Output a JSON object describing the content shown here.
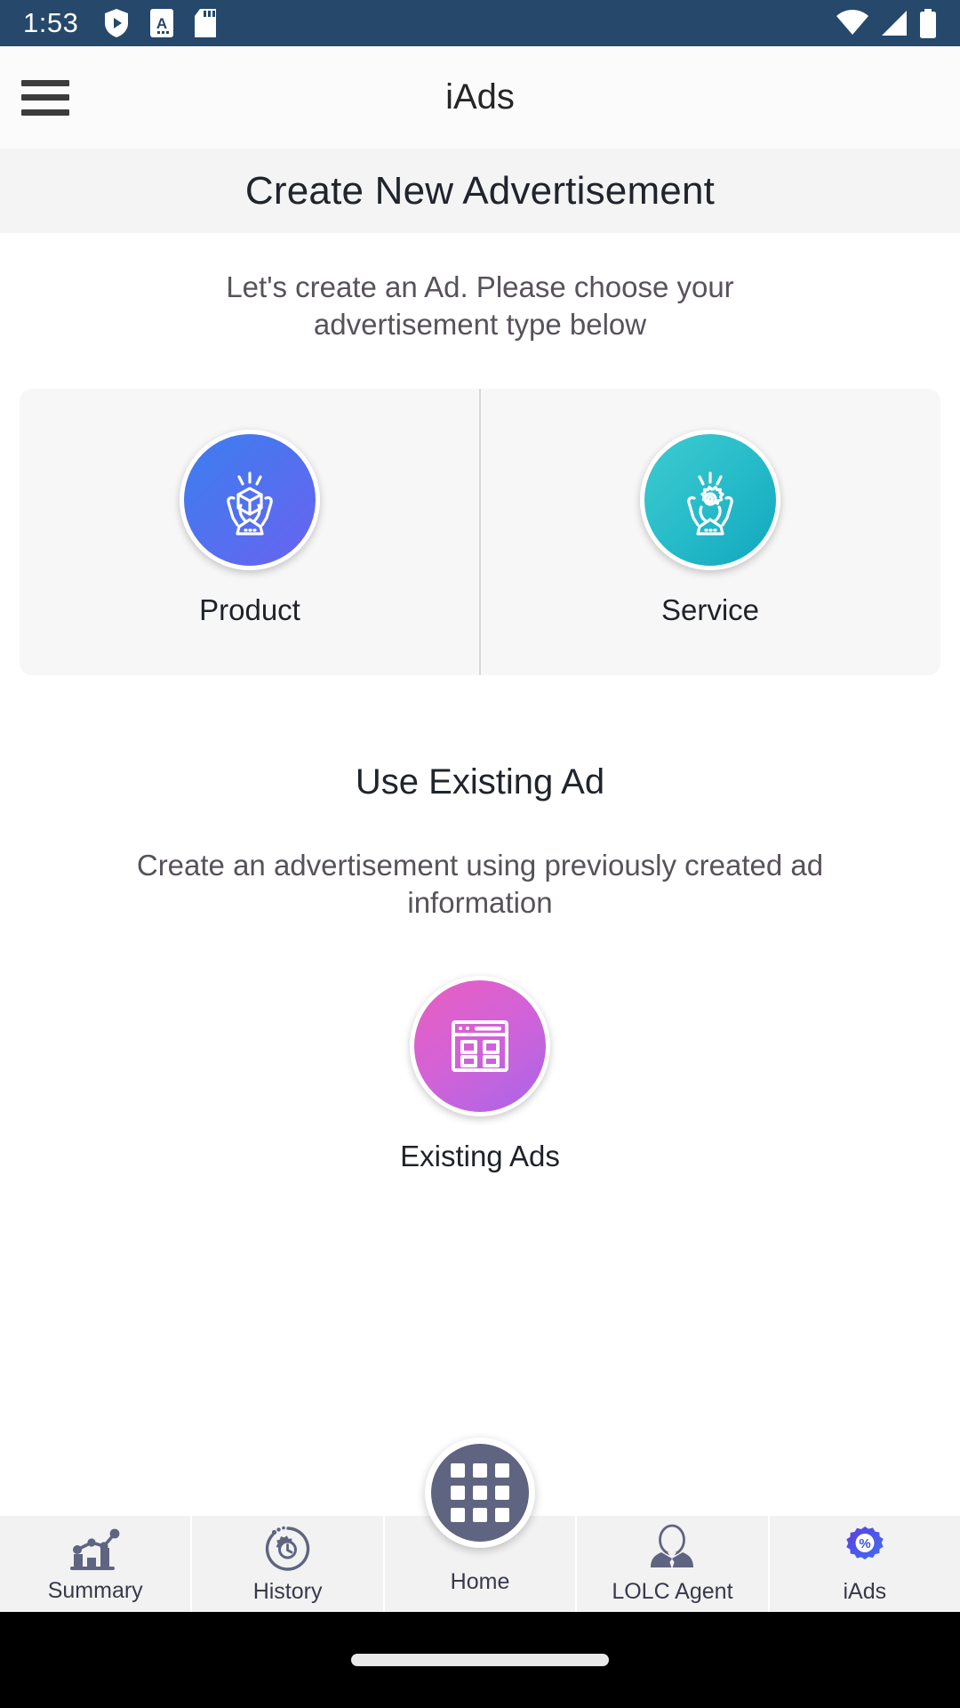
{
  "status_bar": {
    "time": "1:53",
    "left_icons": [
      "play-protect-shield-icon",
      "document-a-icon",
      "sd-card-icon"
    ],
    "right_icons": [
      "wifi-icon",
      "cellular-signal-icon",
      "battery-icon"
    ],
    "background_color": "#25486b"
  },
  "app_bar": {
    "menu_icon": "hamburger-menu-icon",
    "title": "iAds"
  },
  "page": {
    "title": "Create New Advertisement",
    "subtitle": "Let's create an Ad. Please choose your advertisement type below"
  },
  "ad_types": [
    {
      "label": "Product",
      "icon": "hands-holding-cube-icon",
      "color": "#4f72ef"
    },
    {
      "label": "Service",
      "icon": "hands-holding-gear-icon",
      "color": "#27bcca"
    }
  ],
  "existing_section": {
    "title": "Use Existing Ad",
    "description": "Create an advertisement using previously created ad information",
    "label": "Existing Ads",
    "icon": "browser-window-grid-icon",
    "color": "#d262d8"
  },
  "bottom_nav": {
    "items": [
      {
        "label": "Summary",
        "icon": "bar-chart-trend-icon"
      },
      {
        "label": "History",
        "icon": "clock-gear-history-icon"
      },
      {
        "label": "Home",
        "icon": "grid-apps-icon"
      },
      {
        "label": "LOLC Agent",
        "icon": "person-suit-icon"
      },
      {
        "label": "iAds",
        "icon": "percent-badge-icon"
      }
    ],
    "accent_color": "#5f6480",
    "iads_color": "#3d53e0"
  }
}
